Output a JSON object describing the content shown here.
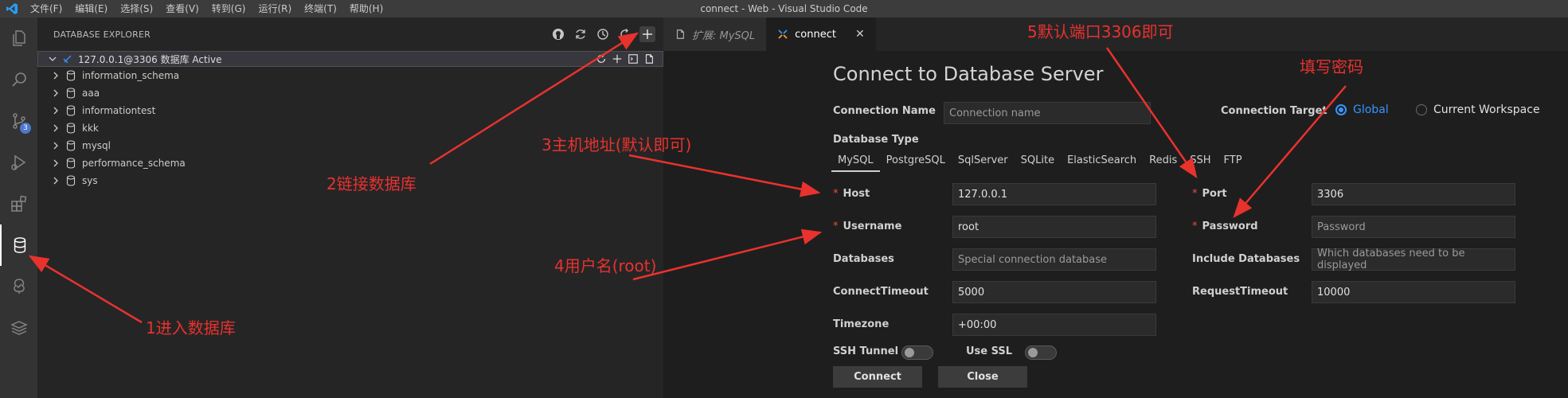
{
  "titlebar": {
    "menu": [
      "文件(F)",
      "编辑(E)",
      "选择(S)",
      "查看(V)",
      "转到(G)",
      "运行(R)",
      "终端(T)",
      "帮助(H)"
    ],
    "window_title": "connect - Web - Visual Studio Code"
  },
  "activitybar": {
    "icons": [
      "explorer-icon",
      "search-icon",
      "source-control-icon",
      "run-debug-icon",
      "extensions-icon",
      "database-icon",
      "testing-icon",
      "layers-icon"
    ],
    "scm_badge": "3",
    "active": "database-icon"
  },
  "sidebar": {
    "title": "DATABASE EXPLORER",
    "connection": "127.0.0.1@3306  数据库 Active",
    "databases": [
      "information_schema",
      "aaa",
      "informationtest",
      "kkk",
      "mysql",
      "performance_schema",
      "sys"
    ]
  },
  "tabs": [
    {
      "label": "扩展: MySQL",
      "active": false
    },
    {
      "label": "connect",
      "active": true
    }
  ],
  "form": {
    "title": "Connect to Database Server",
    "connection_name_label": "Connection Name",
    "connection_name_placeholder": "Connection name",
    "connection_target_label": "Connection Target",
    "target_global": "Global",
    "target_workspace": "Current Workspace",
    "database_type_label": "Database Type",
    "db_types": [
      "MySQL",
      "PostgreSQL",
      "SqlServer",
      "SQLite",
      "ElasticSearch",
      "Redis",
      "SSH",
      "FTP"
    ],
    "host_label": "Host",
    "host_value": "127.0.0.1",
    "port_label": "Port",
    "port_value": "3306",
    "username_label": "Username",
    "username_value": "root",
    "password_label": "Password",
    "password_placeholder": "Password",
    "databases_label": "Databases",
    "databases_placeholder": "Special connection database",
    "include_databases_label": "Include Databases",
    "include_databases_placeholder": "Which databases need to be displayed",
    "connect_timeout_label": "ConnectTimeout",
    "connect_timeout_value": "5000",
    "request_timeout_label": "RequestTimeout",
    "request_timeout_value": "10000",
    "timezone_label": "Timezone",
    "timezone_value": "+00:00",
    "ssh_tunnel_label": "SSH Tunnel",
    "use_ssl_label": "Use SSL",
    "connect_button": "Connect",
    "close_button": "Close"
  },
  "annotations": {
    "a1": "1进入数据库",
    "a2": "2链接数据库",
    "a3": "3主机地址(默认即可)",
    "a4": "4用户名(root)",
    "a5": "5默认端口3306即可",
    "a6": "填写密码",
    "color": "#e8322e"
  }
}
